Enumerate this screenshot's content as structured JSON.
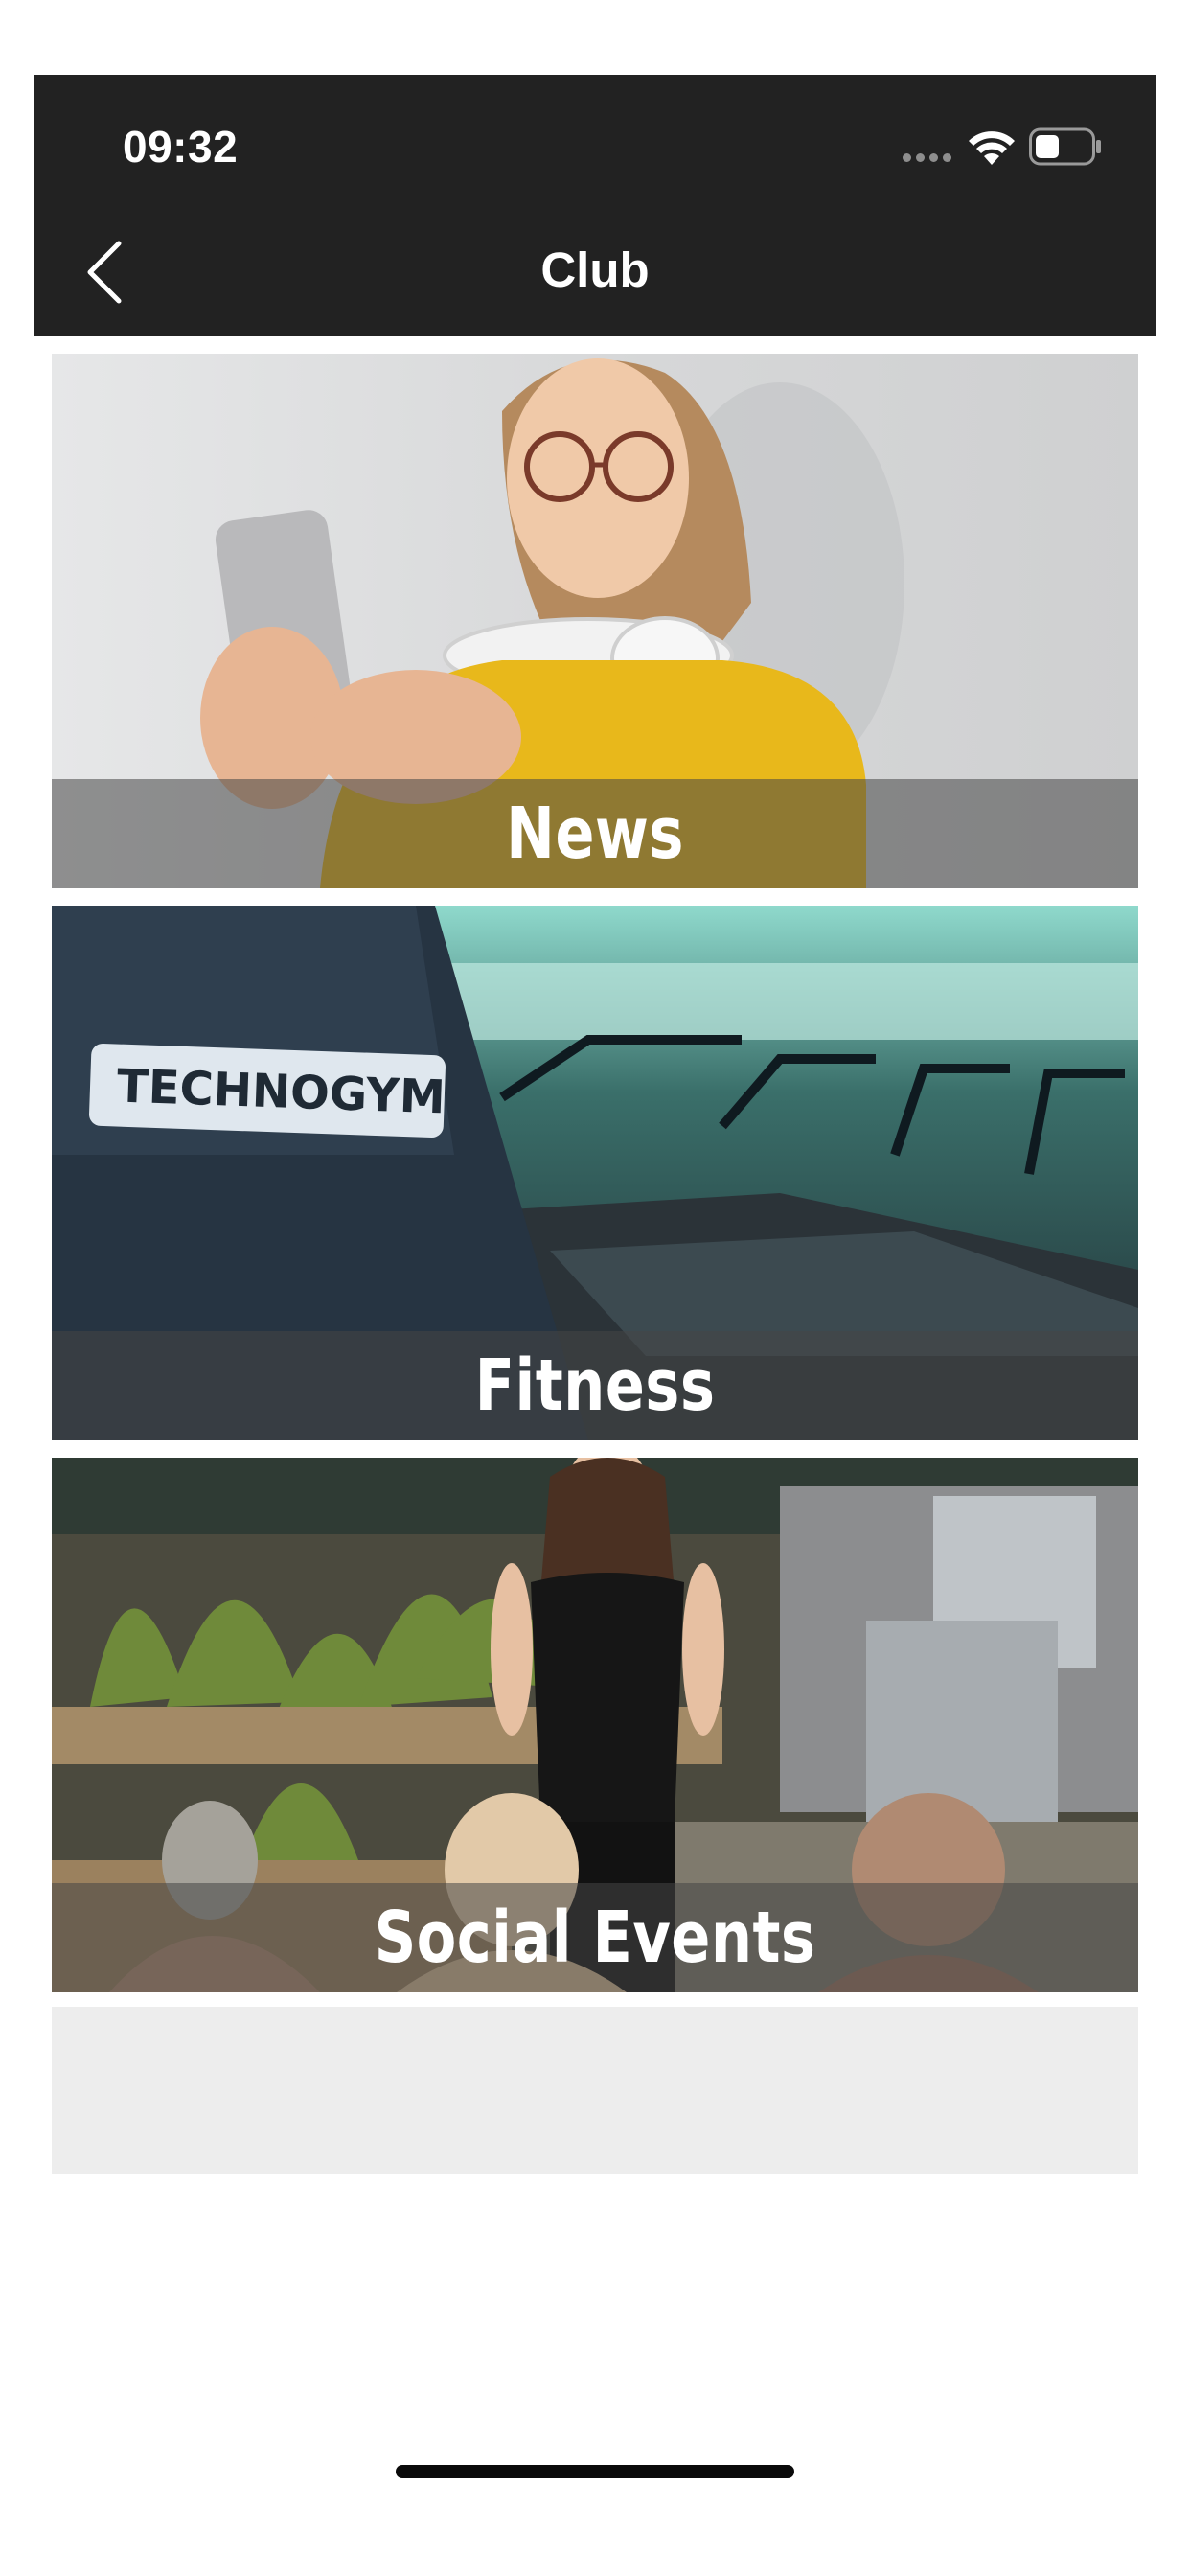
{
  "status_bar": {
    "time": "09:32"
  },
  "nav": {
    "title": "Club",
    "back_icon": "chevron-left-icon"
  },
  "tiles": [
    {
      "label": "News",
      "image": "woman-with-phone-and-headphones"
    },
    {
      "label": "Fitness",
      "image": "technogym-treadmills"
    },
    {
      "label": "Social Events",
      "image": "outdoor-instructor-class"
    }
  ],
  "colors": {
    "header_bg": "#222222",
    "placeholder_bg": "#ededed",
    "band": "rgba(70,70,70,0.55)"
  }
}
